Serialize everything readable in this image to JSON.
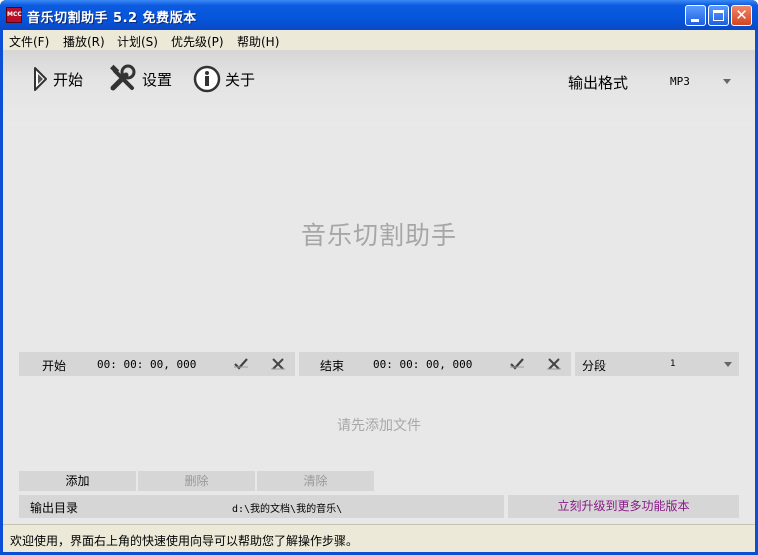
{
  "window": {
    "icon_text": "MCC",
    "title": "音乐切割助手 5.2 免费版本"
  },
  "menu": [
    {
      "label": "文件(F)"
    },
    {
      "label": "播放(R)"
    },
    {
      "label": "计划(S)"
    },
    {
      "label": "优先级(P)"
    },
    {
      "label": "帮助(H)"
    }
  ],
  "toolbar": {
    "start_label": "开始",
    "settings_label": "设置",
    "about_label": "关于",
    "output_format_label": "输出格式",
    "output_format_value": "MP3"
  },
  "main": {
    "watermark": "音乐切割助手",
    "hint": "请先添加文件"
  },
  "time": {
    "start_label": "开始",
    "start_value": "00:  00:  00,  000",
    "end_label": "结束",
    "end_value": "00:  00:  00,  000",
    "segment_label": "分段",
    "segment_value": "1"
  },
  "buttons": {
    "add": "添加",
    "delete": "删除",
    "clear": "清除"
  },
  "output": {
    "dir_label": "输出目录",
    "dir_path": "d:\\我的文档\\我的音乐\\",
    "upgrade_label": "立刻升级到更多功能版本"
  },
  "status": {
    "text": "欢迎使用，界面右上角的快速使用向导可以帮助您了解操作步骤。"
  },
  "colors": {
    "titlebar": "#0556dc",
    "upgrade_text": "#8a1a8a",
    "panel": "#d6d6d6"
  }
}
